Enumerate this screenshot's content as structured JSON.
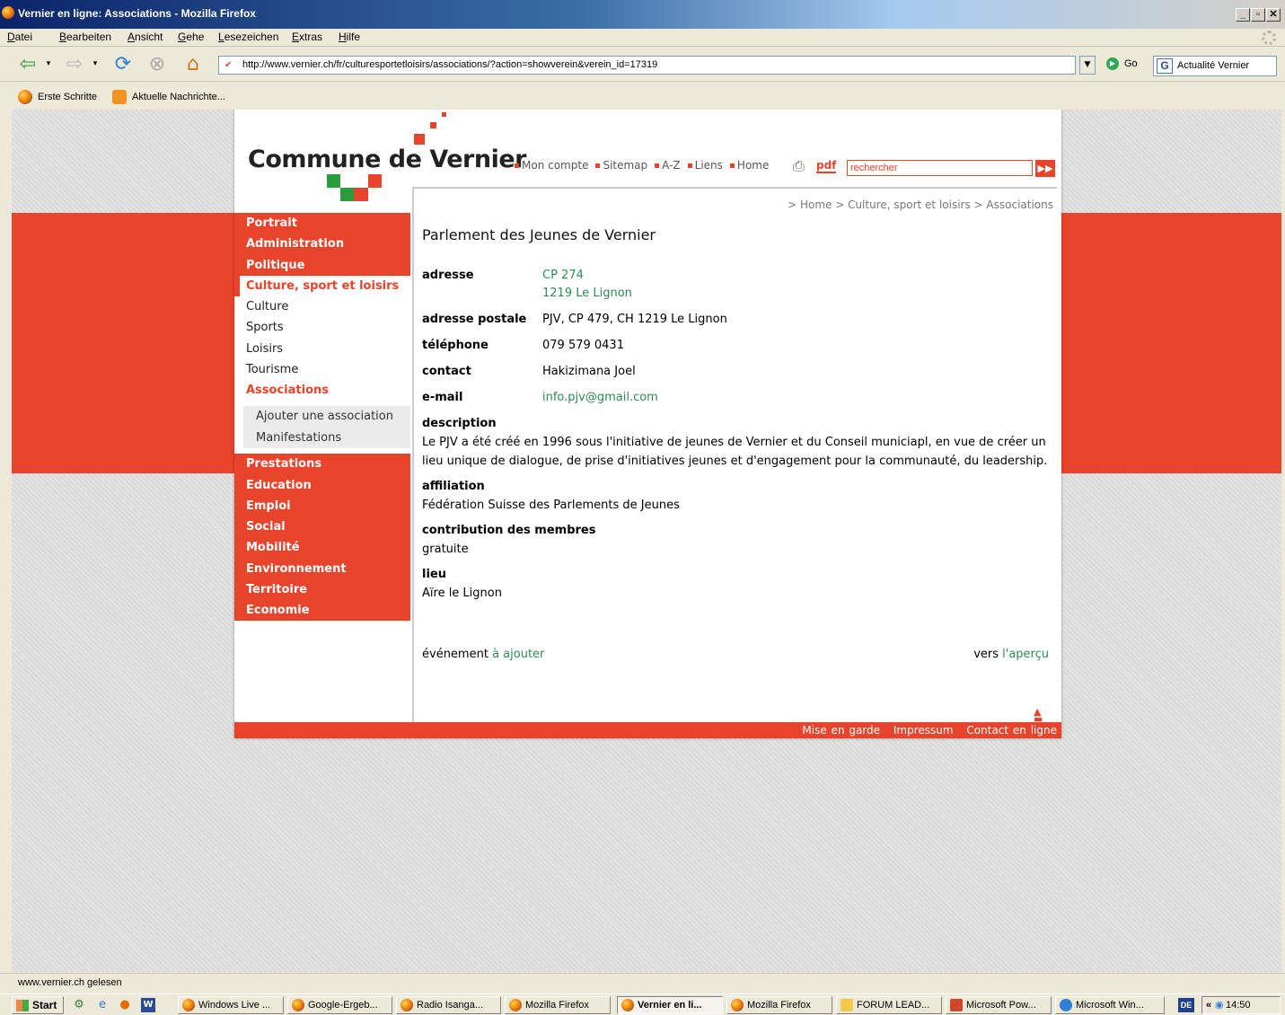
{
  "window": {
    "title": "Vernier en ligne: Associations - Mozilla Firefox"
  },
  "menu": [
    "Datei",
    "Bearbeiten",
    "Ansicht",
    "Gehe",
    "Lesezeichen",
    "Extras",
    "Hilfe"
  ],
  "nav": {
    "url": "http://www.vernier.ch/fr/culturesportetloisirs/associations/?action=showverein&verein_id=17319",
    "go_label": "Go",
    "search_value": "Actualité Vernier"
  },
  "bookmarks": [
    "Erste Schritte",
    "Aktuelle Nachrichte..."
  ],
  "site": {
    "logo_text": "Commune de Vernier",
    "top_links": [
      "Mon compte",
      "Sitemap",
      "A-Z",
      "Liens",
      "Home"
    ],
    "pdf_label": "pdf",
    "search_placeholder": "rechercher",
    "search_go": "▶▶",
    "breadcrumb": "> Home > Culture, sport et loisirs > Associations",
    "left_nav_top": [
      "Portrait",
      "Administration",
      "Politique"
    ],
    "left_nav_current": "Culture, sport et loisirs",
    "left_nav_sub": [
      "Culture",
      "Sports",
      "Loisirs",
      "Tourisme"
    ],
    "left_nav_sub_active": "Associations",
    "left_nav_subsub": [
      "Ajouter une association",
      "Manifestations"
    ],
    "left_nav_bottom": [
      "Prestations",
      "Education",
      "Emploi",
      "Social",
      "Mobilité",
      "Environnement",
      "Territoire",
      "Economie"
    ],
    "footer": [
      "Mise en garde",
      "Impressum",
      "Contact en ligne"
    ]
  },
  "assoc": {
    "title": "Parlement des Jeunes de Vernier",
    "adresse_label": "adresse",
    "adresse_line1": "CP 274",
    "adresse_line2": "1219 Le Lignon",
    "postale_label": "adresse postale",
    "postale_value": "PJV, CP 479, CH 1219 Le Lignon",
    "tel_label": "téléphone",
    "tel_value": "079 579 0431",
    "contact_label": "contact",
    "contact_value": "Hakizimana Joel",
    "email_label": "e-mail",
    "email_value": "info.pjv@gmail.com",
    "description_label": "description",
    "description_text": "Le PJV a été créé en 1996 sous l'initiative de jeunes de Vernier et du Conseil municiapl, en vue de créer un lieu unique de dialogue, de prise d'initiatives jeunes et d'engagement pour la communauté, du leadership.",
    "affiliation_label": "affiliation",
    "affiliation_text": "Fédération Suisse des Parlements de Jeunes",
    "contribution_label": "contribution des membres",
    "contribution_text": "gratuite",
    "lieu_label": "lieu",
    "lieu_text": "Aïre le Lignon",
    "event_prefix": "événement",
    "event_link": "à ajouter",
    "preview_prefix": "vers",
    "preview_link": "l'aperçu"
  },
  "status": "www.vernier.ch gelesen",
  "taskbar": {
    "start": "Start",
    "items": [
      "Windows Live ...",
      "Google-Ergeb...",
      "Radio Isanga...",
      "Mozilla Firefox",
      "Vernier en li...",
      "Mozilla Firefox",
      "FORUM LEAD...",
      "Microsoft Pow...",
      "Microsoft Win..."
    ],
    "lang": "DE",
    "clock": "14:50"
  },
  "colors": {
    "accent": "#e8432b",
    "link": "#2e8b57",
    "logo_green": "#2a9d3a"
  }
}
